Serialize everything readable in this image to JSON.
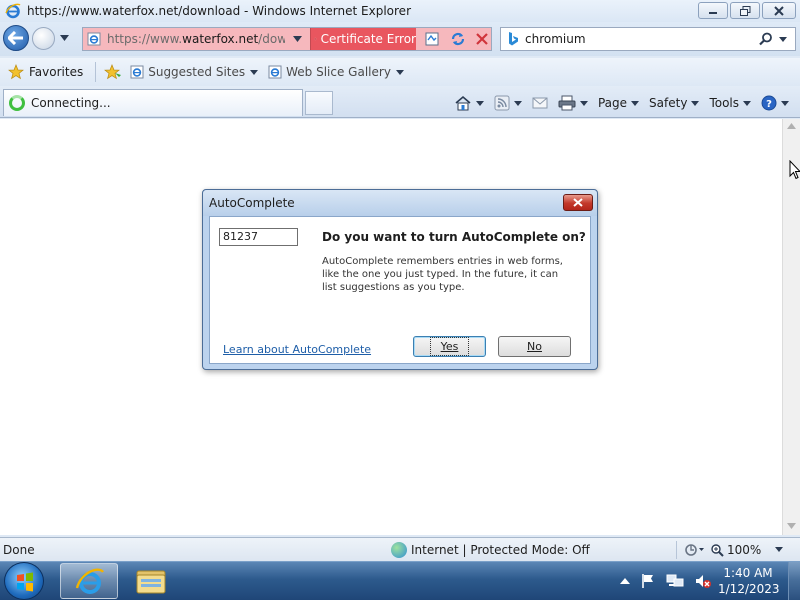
{
  "window": {
    "title": "https://www.waterfox.net/download - Windows Internet Explorer"
  },
  "address_bar": {
    "url_prefix": "https://www.",
    "url_domain": "waterfox.net",
    "url_suffix": "/downlo",
    "certificate_error_label": "Certificate Error",
    "background_color": "#f6b8bd",
    "cert_color": "#e9565f"
  },
  "search": {
    "value": "chromium",
    "provider_icon": "bing-icon"
  },
  "favorites_bar": {
    "favorites_label": "Favorites",
    "links": [
      {
        "label": "Suggested Sites"
      },
      {
        "label": "Web Slice Gallery"
      }
    ]
  },
  "tab": {
    "label": "Connecting..."
  },
  "command_bar": {
    "page_label": "Page",
    "safety_label": "Safety",
    "tools_label": "Tools"
  },
  "dialog": {
    "title": "AutoComplete",
    "sample_value": "81237",
    "question": "Do you want to turn AutoComplete on?",
    "description": "AutoComplete remembers entries in web forms, like the one you just typed. In the future, it can list suggestions as you type.",
    "learn_link": "Learn about AutoComplete",
    "yes_label": "Yes",
    "no_label": "No"
  },
  "status_bar": {
    "status": "Done",
    "zone": "Internet | Protected Mode: Off",
    "zoom": "100%"
  },
  "taskbar": {
    "time": "1:40 AM",
    "date": "1/12/2023"
  }
}
